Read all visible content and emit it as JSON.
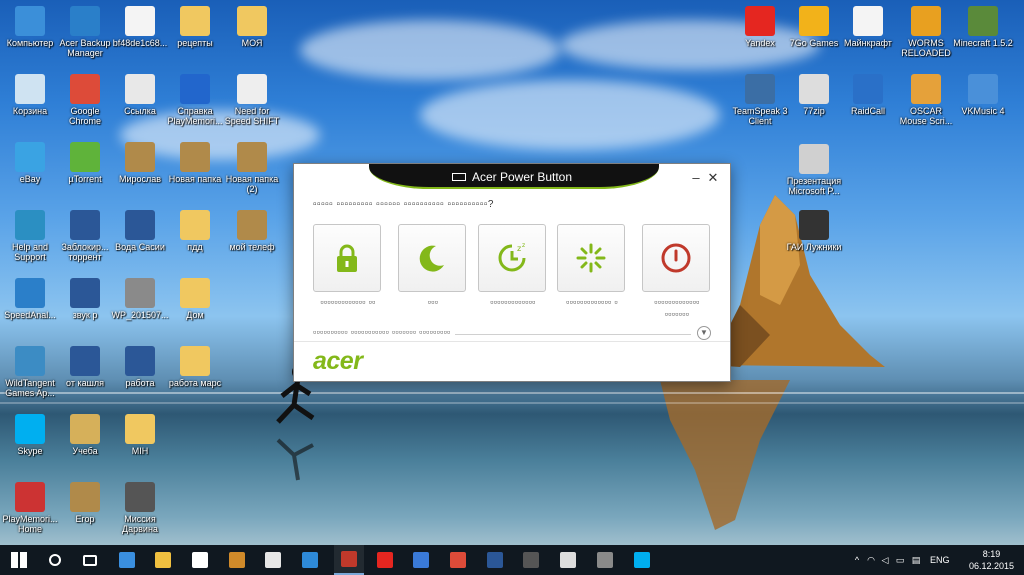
{
  "desktop_icons_left": [
    {
      "label": "Компьютер",
      "icon": "computer-icon",
      "color": "#3b8fd9"
    },
    {
      "label": "Acer Backup Manager",
      "icon": "acer-backup-icon",
      "color": "#2a7fc9"
    },
    {
      "label": "bf48de1c68...",
      "icon": "file-icon",
      "color": "#f4f4f4"
    },
    {
      "label": "рецепты",
      "icon": "folder-icon",
      "color": "#f0c860"
    },
    {
      "label": "МОЯ",
      "icon": "folder-icon",
      "color": "#f0c860"
    },
    {
      "label": "Корзина",
      "icon": "recycle-bin-icon",
      "color": "#cfe3f2"
    },
    {
      "label": "Google Chrome",
      "icon": "chrome-icon",
      "color": "#dd4b39"
    },
    {
      "label": "Ссылка",
      "icon": "shortcut-icon",
      "color": "#e8e8e8"
    },
    {
      "label": "Справка PlayMemori...",
      "icon": "help-icon",
      "color": "#2266cc"
    },
    {
      "label": "Need for Speed SHIFT",
      "icon": "nfs-icon",
      "color": "#eeeeee"
    },
    {
      "label": "eBay",
      "icon": "ebay-icon",
      "color": "#3aa3e3"
    },
    {
      "label": "µTorrent",
      "icon": "utorrent-icon",
      "color": "#5fb33a"
    },
    {
      "label": "Мирослав",
      "icon": "folder-icon",
      "color": "#b08a4a"
    },
    {
      "label": "Новая папка",
      "icon": "folder-icon",
      "color": "#b08a4a"
    },
    {
      "label": "Новая папка (2)",
      "icon": "folder-icon",
      "color": "#b08a4a"
    },
    {
      "label": "Help and Support",
      "icon": "help-support-icon",
      "color": "#2b8fc2"
    },
    {
      "label": "Заблокир... торрент",
      "icon": "word-doc-icon",
      "color": "#2b5797"
    },
    {
      "label": "Вода Сасии",
      "icon": "word-doc-icon",
      "color": "#2b5797"
    },
    {
      "label": "пдд",
      "icon": "folder-icon",
      "color": "#f0c860"
    },
    {
      "label": "мой телеф",
      "icon": "folder-icon",
      "color": "#b08a4a"
    },
    {
      "label": "SpeedAnal...",
      "icon": "speed-icon",
      "color": "#2b7fc9"
    },
    {
      "label": "звук р",
      "icon": "word-doc-icon",
      "color": "#2b5797"
    },
    {
      "label": "WP_201507...",
      "icon": "image-icon",
      "color": "#8a8a8a"
    },
    {
      "label": "Дом",
      "icon": "folder-icon",
      "color": "#f0c860"
    },
    {
      "label": "WildTangent Games Ap...",
      "icon": "wildtangent-icon",
      "color": "#3c8cc4"
    },
    {
      "label": "от кашля",
      "icon": "word-doc-icon",
      "color": "#2b5797"
    },
    {
      "label": "работа",
      "icon": "word-doc-icon",
      "color": "#2b5797"
    },
    {
      "label": "работа марс",
      "icon": "folder-icon",
      "color": "#f0c860"
    },
    {
      "label": "Skype",
      "icon": "skype-icon",
      "color": "#00aff0"
    },
    {
      "label": "Учеба",
      "icon": "folder-icon",
      "color": "#d6b05a"
    },
    {
      "label": "MIH",
      "icon": "folder-icon",
      "color": "#f0c860"
    },
    {
      "label": "PlayMemori... Home",
      "icon": "playmemories-icon",
      "color": "#cc3333"
    },
    {
      "label": "Егор",
      "icon": "folder-icon",
      "color": "#b08a4a"
    },
    {
      "label": "Миссия Дарвина",
      "icon": "game-icon",
      "color": "#555555"
    }
  ],
  "desktop_icons_right": [
    {
      "label": "Yandex",
      "icon": "yandex-icon",
      "color": "#e52620"
    },
    {
      "label": "7Go Games",
      "icon": "7go-icon",
      "color": "#f2b21a"
    },
    {
      "label": "Майнкрафт",
      "icon": "file-icon",
      "color": "#f4f4f4"
    },
    {
      "label": "WORMS RELOADED",
      "icon": "worms-icon",
      "color": "#e8a020"
    },
    {
      "label": "Minecraft 1.5.2",
      "icon": "minecraft-icon",
      "color": "#5a8a3a"
    },
    {
      "label": "TeamSpeak 3 Client",
      "icon": "teamspeak-icon",
      "color": "#3b6ea5"
    },
    {
      "label": "77zip",
      "icon": "zip-icon",
      "color": "#dddddd"
    },
    {
      "label": "RaidCall",
      "icon": "raidcall-icon",
      "color": "#2a70c8"
    },
    {
      "label": "OSCAR Mouse Scri...",
      "icon": "oscar-icon",
      "color": "#e5a13a"
    },
    {
      "label": "VKMusic 4",
      "icon": "vkmusic-icon",
      "color": "#4a90d9"
    },
    {
      "label": "Презентация Microsoft P...",
      "icon": "powerpoint-icon",
      "color": "#d0d0d0"
    },
    {
      "label": "ГАИ Лужники",
      "icon": "video-icon",
      "color": "#333333"
    }
  ],
  "dialog": {
    "title": "Acer Power Button",
    "minimize_label": "–",
    "close_label": "✕",
    "question": "▫▫▫▫▫ ▫▫▫▫▫▫▫▫▫ ▫▫▫▫▫▫ ▫▫▫▫▫▫▫▫▫▫ ▫▫▫▫▫▫▫▫▫▫?",
    "tiles": [
      {
        "label": "▫▫▫▫▫▫▫▫▫▫▫▫▫ ▫▫",
        "icon": "lock-icon",
        "color": "#83b81a"
      },
      {
        "label": "▫▫▫",
        "icon": "sleep-moon-icon",
        "color": "#83b81a"
      },
      {
        "label": "▫▫▫▫▫▫▫▫▫▫▫▫▫",
        "icon": "hibernate-icon",
        "color": "#83b81a"
      },
      {
        "label": "▫▫▫▫▫▫▫▫▫▫▫▫▫ ▫",
        "icon": "restart-icon",
        "color": "#83b81a"
      },
      {
        "label": "▫▫▫▫▫▫▫▫▫▫▫▫▫ ▫▫▫▫▫▫▫",
        "icon": "shutdown-icon",
        "color": "#c0392b"
      }
    ],
    "more_options": "▫▫▫▫▫▫▫▫▫▫ ▫▫▫▫▫▫▫▫▫▫▫ ▫▫▫▫▫▫▫ ▫▫▫▫▫▫▫▫▫",
    "brand": "acer",
    "brand_color": "#83b81a"
  },
  "taskbar": {
    "apps": [
      {
        "name": "start-button",
        "icon": "windows-icon",
        "color": "#ffffff"
      },
      {
        "name": "search-button",
        "icon": "search-icon",
        "color": "#ffffff"
      },
      {
        "name": "task-view-button",
        "icon": "task-view-icon",
        "color": "#ffffff"
      },
      {
        "name": "edge-app",
        "icon": "edge-icon",
        "color": "#3a8fe0"
      },
      {
        "name": "explorer-app",
        "icon": "folder-icon",
        "color": "#f0c040"
      },
      {
        "name": "store-app",
        "icon": "store-icon",
        "color": "#ffffff"
      },
      {
        "name": "app-6",
        "icon": "app-icon",
        "color": "#d08a2a"
      },
      {
        "name": "app-7",
        "icon": "app-icon",
        "color": "#e6e6e6"
      },
      {
        "name": "app-8",
        "icon": "app-icon",
        "color": "#2e8ad8"
      },
      {
        "name": "acer-power-app",
        "icon": "power-icon",
        "color": "#c0392b"
      },
      {
        "name": "yandex-app",
        "icon": "yandex-icon",
        "color": "#e52620"
      },
      {
        "name": "app-11",
        "icon": "app-icon",
        "color": "#3a7ad8"
      },
      {
        "name": "chrome-app",
        "icon": "chrome-icon",
        "color": "#dd4b39"
      },
      {
        "name": "word-app",
        "icon": "word-icon",
        "color": "#2b5797"
      },
      {
        "name": "app-14",
        "icon": "app-icon",
        "color": "#555555"
      },
      {
        "name": "calculator-app",
        "icon": "calculator-icon",
        "color": "#dddddd"
      },
      {
        "name": "app-16",
        "icon": "app-icon",
        "color": "#8a8a8a"
      },
      {
        "name": "skype-app",
        "icon": "skype-icon",
        "color": "#00aff0"
      }
    ],
    "language": "ENG",
    "time": "8:19",
    "date": "06.12.2015"
  }
}
